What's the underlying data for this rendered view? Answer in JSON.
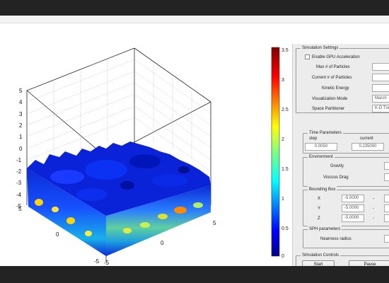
{
  "plot": {
    "z_ticks": [
      "5",
      "4",
      "3",
      "2",
      "1",
      "0",
      "-1",
      "-2",
      "-3",
      "-4",
      "-5"
    ],
    "x_ticks": [
      "-5",
      "0",
      "5"
    ],
    "y_ticks": [
      "5",
      "0",
      "-5"
    ]
  },
  "colorbar": {
    "ticks": [
      "3.5",
      "3",
      "2.5",
      "2",
      "1.5",
      "1",
      "0.5",
      "0"
    ],
    "range": [
      0,
      3.5
    ],
    "colormap": "jet"
  },
  "panel": {
    "settings": {
      "title": "Simulation Settings",
      "gpu_label": "Enable GPU Acceleration",
      "max_particles_label": "Max # of Particles",
      "current_particles_label": "Current # of Particles",
      "kinetic_energy_label": "Kinetic Energy",
      "vis_mode_label": "Visualization Mode",
      "vis_mode_value": "March",
      "partitioner_label": "Space Partitioner",
      "partitioner_value": "K-D Tree"
    },
    "time": {
      "title": "Time Parameters",
      "step_label": "step",
      "current_label": "current",
      "step_value": "0.0050",
      "current_value": "0.235000"
    },
    "environment": {
      "title": "Environment",
      "gravity_label": "Gravity",
      "drag_label": "Viscous Drag"
    },
    "bbox": {
      "title": "Bounding Box",
      "x_label": "X",
      "y_label": "Y",
      "z_label": "Z",
      "x_min": "-5.0000",
      "y_min": "-5.0000",
      "z_min": "-5.0000",
      "sep": "-"
    },
    "sph": {
      "title": "SPH parameters",
      "nearness_label": "Nearness radius"
    },
    "controls": {
      "title": "Simulation Controls",
      "start_label": "Start",
      "pause_label": "Pause"
    }
  }
}
